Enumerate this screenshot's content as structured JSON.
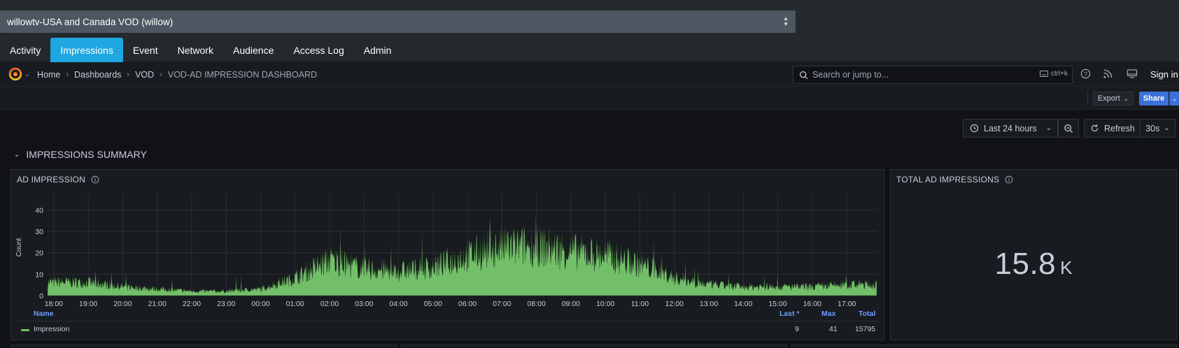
{
  "app": {
    "selector_value": "willowtv-USA and Canada VOD (willow)",
    "tabs": [
      {
        "label": "Activity",
        "active": false
      },
      {
        "label": "Impressions",
        "active": true
      },
      {
        "label": "Event",
        "active": false
      },
      {
        "label": "Network",
        "active": false
      },
      {
        "label": "Audience",
        "active": false
      },
      {
        "label": "Access Log",
        "active": false
      },
      {
        "label": "Admin",
        "active": false
      }
    ],
    "accent_color": "#1ea7e1"
  },
  "header": {
    "breadcrumb": [
      "Home",
      "Dashboards",
      "VOD",
      "VOD-AD IMPRESSION DASHBOARD"
    ],
    "search_placeholder": "Search or jump to...",
    "search_shortcut": "ctrl+k",
    "icons": [
      "grafana-logo-icon",
      "help-icon",
      "rss-icon",
      "monitor-icon"
    ],
    "signin_label": "Sign in"
  },
  "toolbar": {
    "export_label": "Export",
    "share_label": "Share",
    "share_color": "#3d71d9"
  },
  "timecontrols": {
    "range_label": "Last 24 hours",
    "refresh_label": "Refresh",
    "interval_label": "30s"
  },
  "row": {
    "title": "IMPRESSIONS SUMMARY"
  },
  "panels": {
    "timeseries": {
      "title": "AD IMPRESSION",
      "legend_headers": {
        "name": "Name",
        "last": "Last *",
        "max": "Max",
        "total": "Total"
      },
      "legend_row": {
        "name": "Impression",
        "last": "9",
        "max": "41",
        "total": "15795"
      },
      "series_color": "#73bf69"
    },
    "stat": {
      "title": "TOTAL AD IMPRESSIONS",
      "value": "15.8",
      "unit": "K"
    }
  },
  "chart_data": {
    "type": "area",
    "ylabel": "Count",
    "ylim": [
      0,
      45
    ],
    "yticks": [
      0,
      10,
      20,
      30,
      40
    ],
    "grid": true,
    "x_ticks": [
      "18:00",
      "19:00",
      "20:00",
      "21:00",
      "22:00",
      "23:00",
      "00:00",
      "01:00",
      "02:00",
      "03:00",
      "04:00",
      "05:00",
      "06:00",
      "07:00",
      "08:00",
      "09:00",
      "10:00",
      "11:00",
      "12:00",
      "13:00",
      "14:00",
      "15:00",
      "16:00",
      "17:00"
    ],
    "series": [
      {
        "name": "Impression",
        "hourly_avg": [
          6,
          6,
          4,
          3,
          2,
          2,
          3,
          8,
          16,
          12,
          11,
          13,
          18,
          22,
          22,
          20,
          18,
          14,
          8,
          5,
          4,
          4,
          4,
          5,
          5
        ],
        "hourly_peak": [
          14,
          13,
          11,
          9,
          8,
          9,
          10,
          17,
          36,
          26,
          24,
          30,
          32,
          40,
          38,
          36,
          40,
          30,
          18,
          12,
          10,
          11,
          11,
          11,
          11
        ]
      }
    ]
  }
}
